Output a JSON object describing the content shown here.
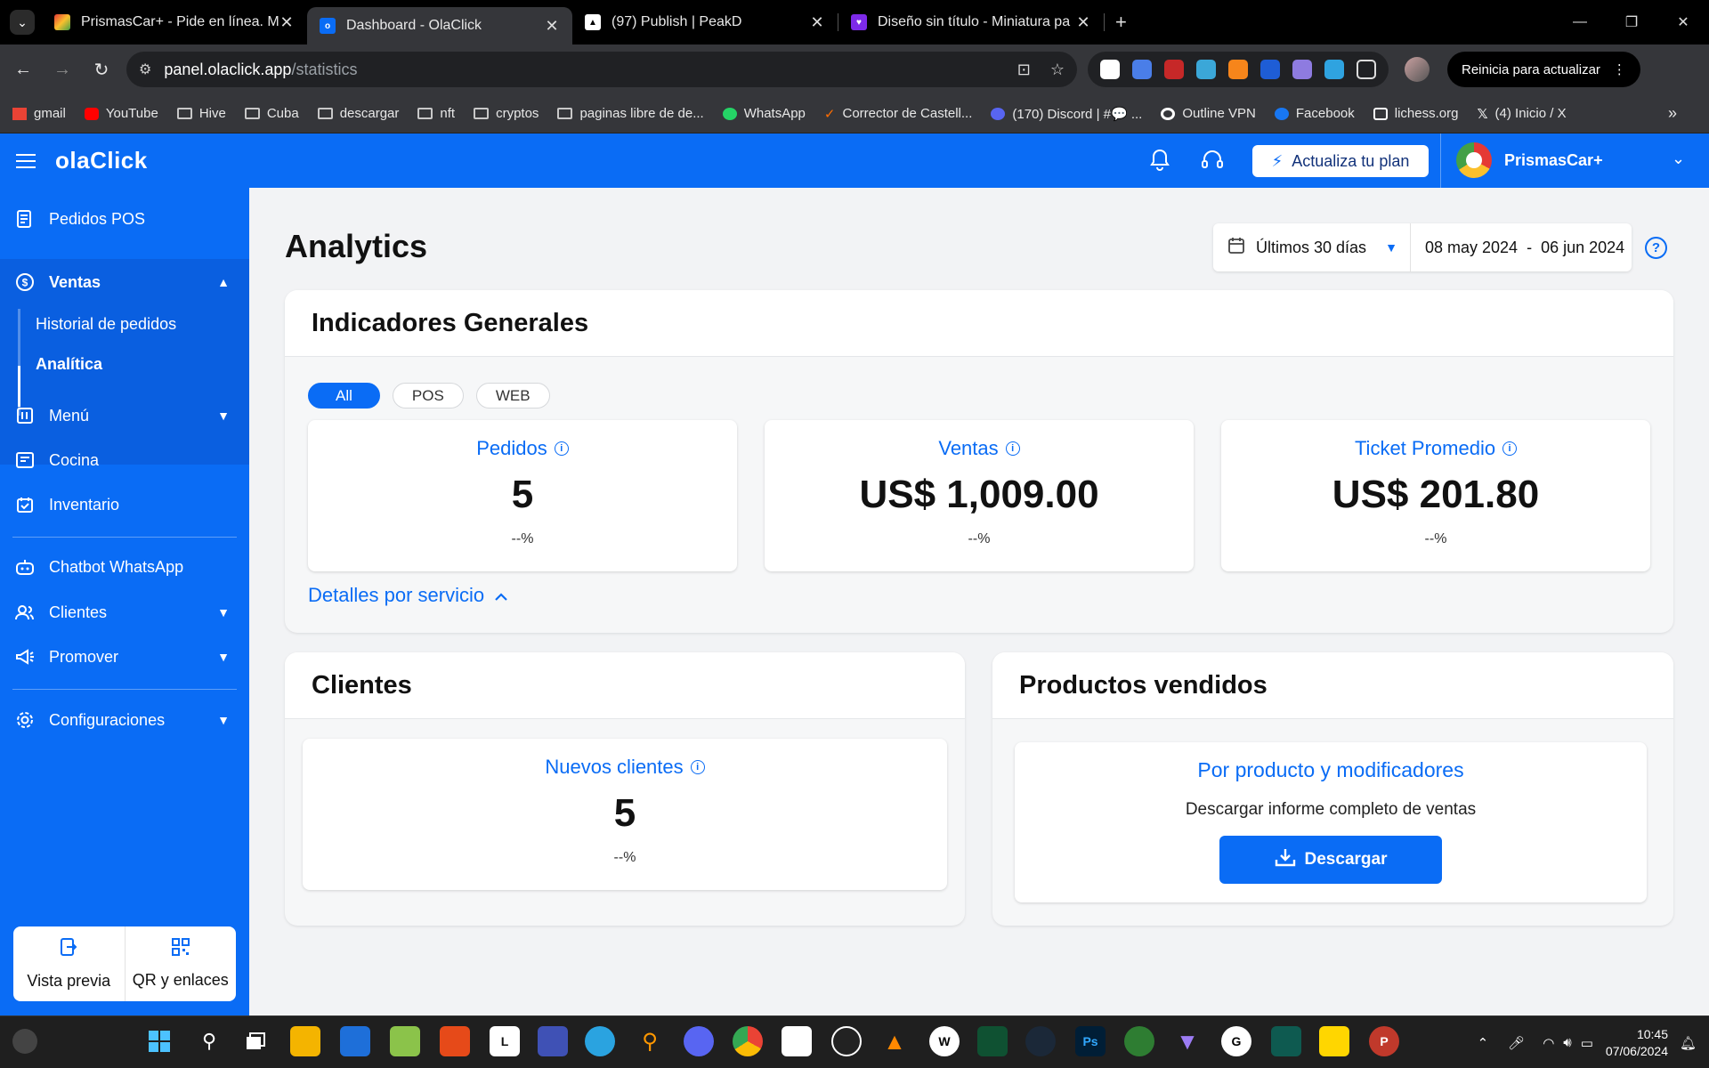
{
  "browser": {
    "tabs": [
      {
        "title": "PrismasCar+ - Pide en línea. Me",
        "active": false
      },
      {
        "title": "Dashboard - OlaClick",
        "active": true
      },
      {
        "title": "(97) Publish | PeakD",
        "active": false
      },
      {
        "title": "Diseño sin título - Miniatura pa",
        "active": false
      }
    ],
    "url_host": "panel.olaclick.app",
    "url_path": "/statistics",
    "relaunch_label": "Reinicia para actualizar",
    "bookmarks": [
      "gmail",
      "YouTube",
      "Hive",
      "Cuba",
      "descargar",
      "nft",
      "cryptos",
      "paginas libre de de...",
      "WhatsApp",
      "Corrector de Castell...",
      "(170) Discord | #💬 ...",
      "Outline VPN",
      "Facebook",
      "lichess.org",
      "(4) Inicio / X"
    ]
  },
  "header": {
    "logo": "olaClick",
    "upgrade_label": "Actualiza tu plan",
    "store_name": "PrismasCar+"
  },
  "sidebar": {
    "pos": "Pedidos POS",
    "ventas": "Ventas",
    "historial": "Historial de pedidos",
    "analitica": "Analítica",
    "menu": "Menú",
    "cocina": "Cocina",
    "inventario": "Inventario",
    "chatbot": "Chatbot WhatsApp",
    "clientes": "Clientes",
    "promover": "Promover",
    "config": "Configuraciones",
    "preview": "Vista previa",
    "qr": "QR y enlaces"
  },
  "main": {
    "title": "Analytics",
    "period": "Últimos 30 días",
    "date_from": "08 may 2024",
    "date_sep": "-",
    "date_to": "06 jun 2024",
    "general": {
      "title": "Indicadores Generales",
      "filters": [
        "All",
        "POS",
        "WEB"
      ],
      "stats": [
        {
          "label": "Pedidos",
          "value": "5",
          "change": "--%"
        },
        {
          "label": "Ventas",
          "value": "US$ 1,009.00",
          "change": "--%"
        },
        {
          "label": "Ticket Promedio",
          "value": "US$ 201.80",
          "change": "--%"
        }
      ],
      "details_label": "Detalles por servicio"
    },
    "clients": {
      "title": "Clientes",
      "new_label": "Nuevos clientes",
      "new_value": "5",
      "new_change": "--%"
    },
    "products": {
      "title": "Productos vendidos",
      "heading": "Por producto y modificadores",
      "desc": "Descargar informe completo de ventas",
      "button": "Descargar"
    }
  },
  "taskbar": {
    "time": "10:45",
    "date": "07/06/2024"
  }
}
